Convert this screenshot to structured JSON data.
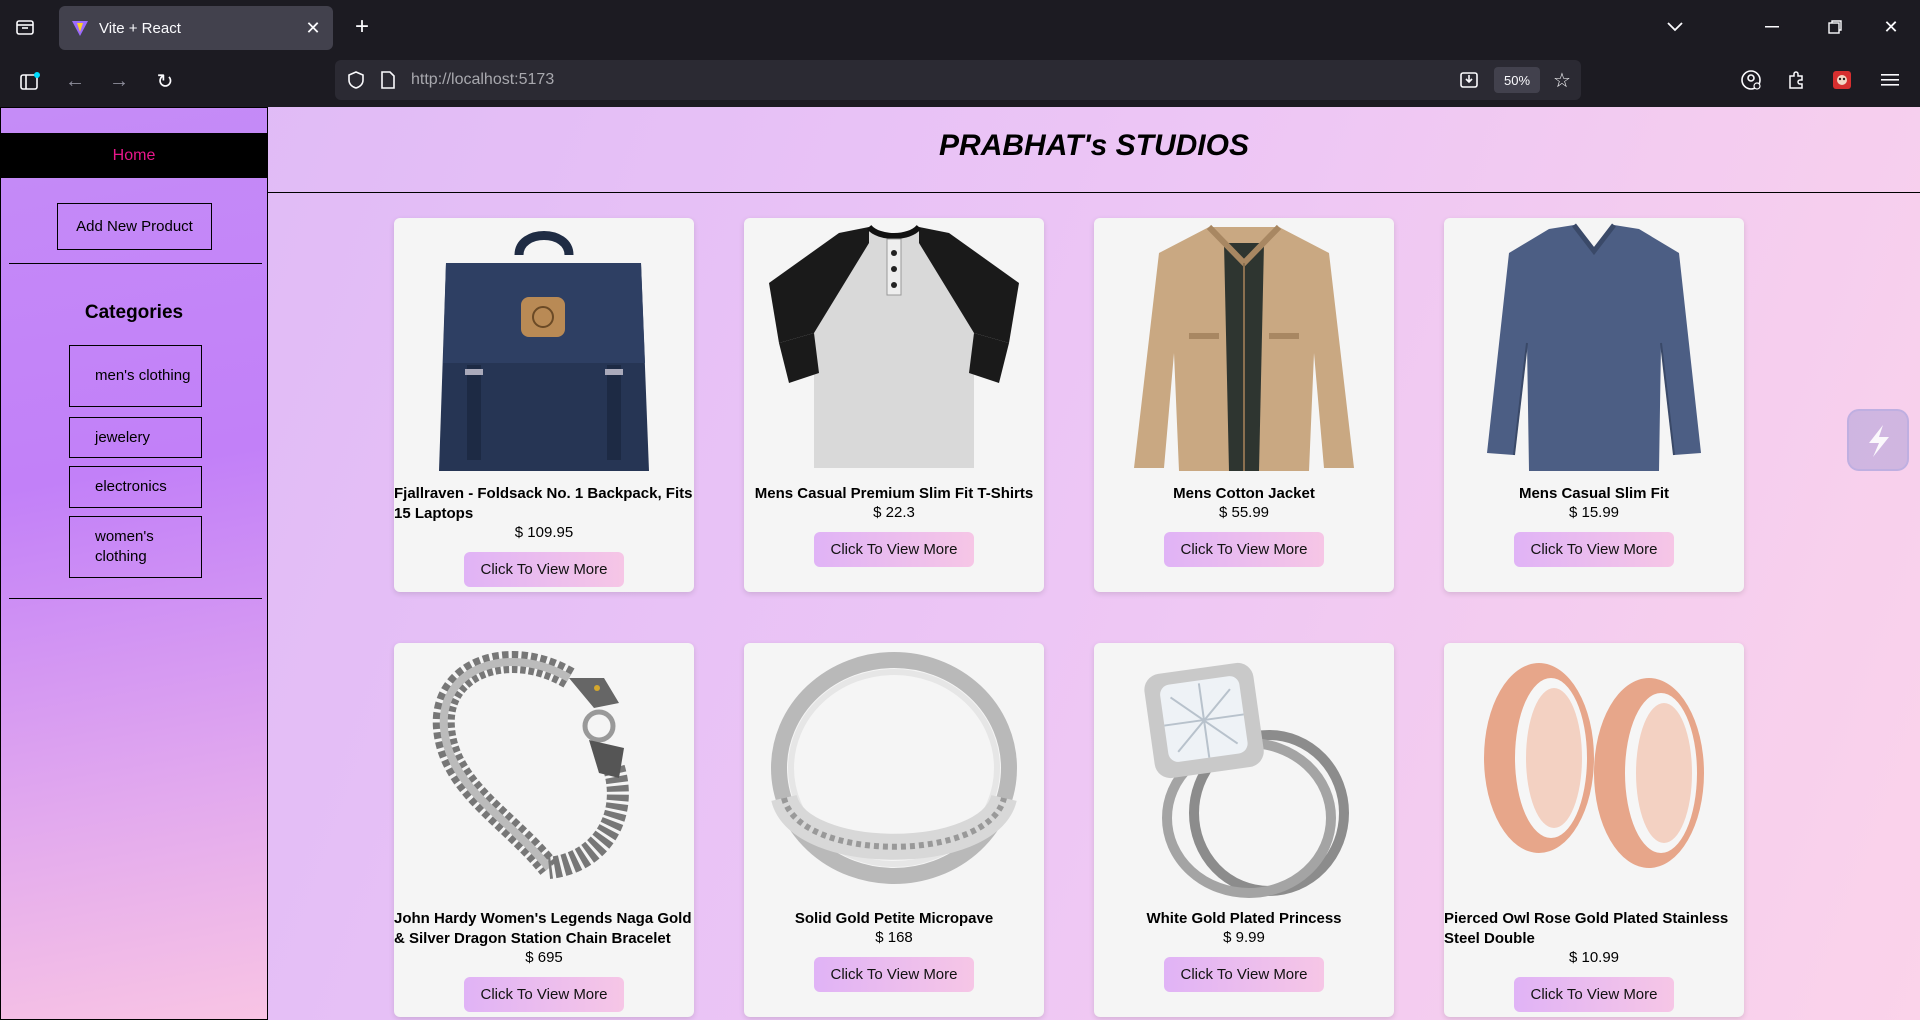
{
  "browser": {
    "tab_title": "Vite + React",
    "url_host": "http://localhost",
    "url_port": ":5173",
    "zoom": "50%"
  },
  "sidebar": {
    "home": "Home",
    "add_product": "Add New Product",
    "categories_title": "Categories",
    "categories": [
      "men's clothing",
      "jewelery",
      "electronics",
      "women's clothing"
    ]
  },
  "header": {
    "brand": "PRABHAT's STUDIOS"
  },
  "products": [
    {
      "title": "Fjallraven - Foldsack No. 1 Backpack, Fits 15 Laptops",
      "price": "$ 109.95",
      "button": "Click To View More",
      "image": "backpack"
    },
    {
      "title": "Mens Casual Premium Slim Fit T-Shirts",
      "price": "$ 22.3",
      "button": "Click To View More",
      "image": "tshirt"
    },
    {
      "title": "Mens Cotton Jacket",
      "price": "$ 55.99",
      "button": "Click To View More",
      "image": "jacket"
    },
    {
      "title": "Mens Casual Slim Fit",
      "price": "$ 15.99",
      "button": "Click To View More",
      "image": "longsleeve"
    },
    {
      "title": "John Hardy Women's Legends Naga Gold & Silver Dragon Station Chain Bracelet",
      "price": "$ 695",
      "button": "Click To View More",
      "image": "bracelet"
    },
    {
      "title": "Solid Gold Petite Micropave",
      "price": "$ 168",
      "button": "Click To View More",
      "image": "ring"
    },
    {
      "title": "White Gold Plated Princess",
      "price": "$ 9.99",
      "button": "Click To View More",
      "image": "diamond-ring"
    },
    {
      "title": "Pierced Owl Rose Gold Plated Stainless Steel Double",
      "price": "$ 10.99",
      "button": "Click To View More",
      "image": "tunnels"
    }
  ]
}
